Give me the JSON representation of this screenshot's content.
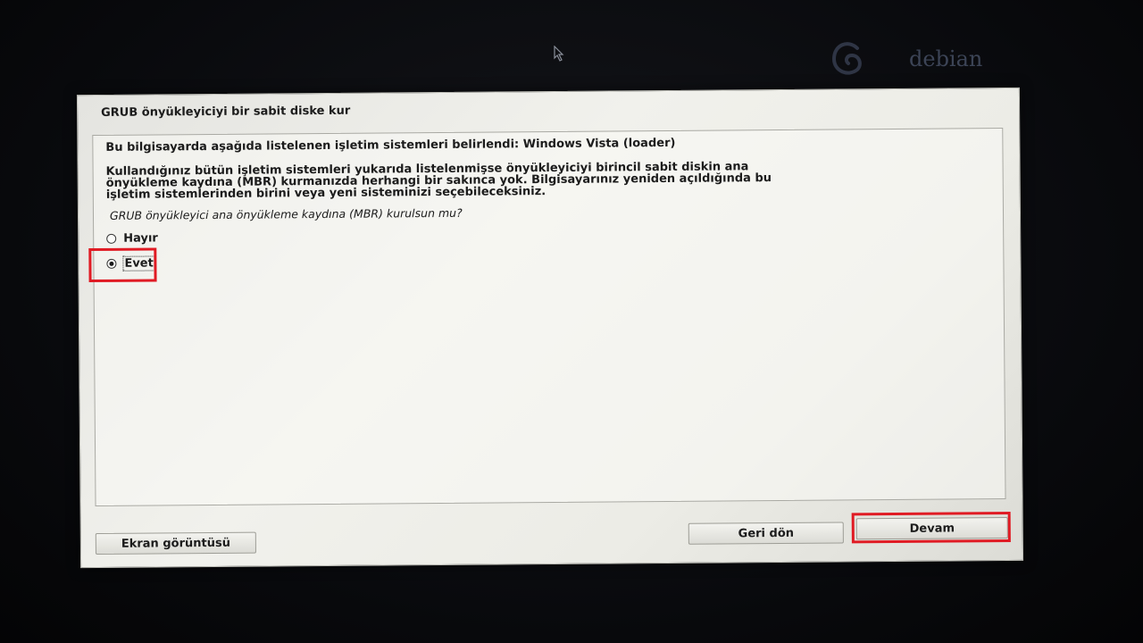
{
  "brand": {
    "name": "debian"
  },
  "dialog": {
    "title": "GRUB önyükleyiciyi bir sabit diske kur",
    "detected": "Bu bilgisayarda aşağıda listelenen işletim sistemleri belirlendi: Windows Vista (loader)",
    "explanation": [
      "Kullandığınız bütün işletim sistemleri yukarıda listelenmişse önyükleyiciyi birincil sabit diskin ana",
      "önyükleme kaydına (MBR) kurmanızda herhangi bir sakınca yok. Bilgisayarınız yeniden açıldığında bu",
      "işletim sistemlerinden birini veya yeni sisteminizi seçebileceksiniz."
    ],
    "question": "GRUB önyükleyici ana önyükleme kaydına (MBR) kurulsun mu?",
    "options": [
      {
        "label": "Hayır",
        "selected": false
      },
      {
        "label": "Evet",
        "selected": true
      }
    ]
  },
  "buttons": {
    "screenshot": "Ekran görüntüsü",
    "back": "Geri dön",
    "continue": "Devam"
  },
  "colors": {
    "highlight": "#e01b24",
    "panel": "#ececE6",
    "background": "#0b0c10"
  }
}
